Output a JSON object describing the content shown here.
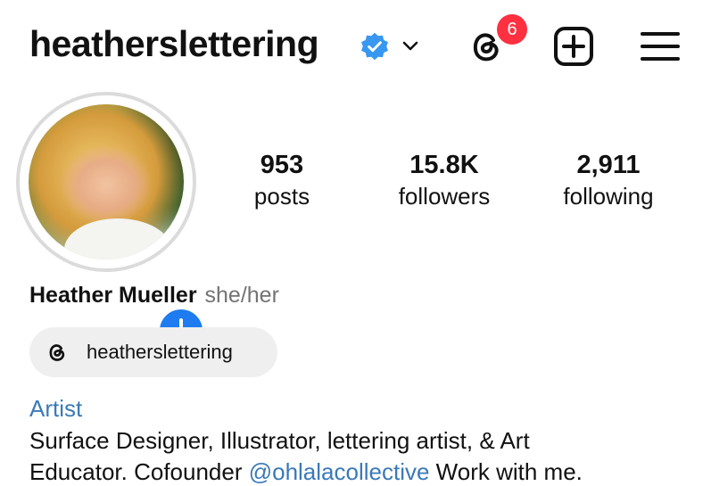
{
  "header": {
    "username": "heatherslettering",
    "verified_icon": "verified-badge-icon",
    "dropdown_icon": "chevron-down-icon",
    "threads_icon": "threads-icon",
    "notification_count": "6",
    "new_post_icon": "plus-square-icon",
    "menu_icon": "hamburger-menu-icon"
  },
  "profile": {
    "avatar_icon": "profile-photo",
    "add_story_icon": "plus-icon",
    "stats": [
      {
        "value": "953",
        "label": "posts"
      },
      {
        "value": "15.8K",
        "label": "followers"
      },
      {
        "value": "2,911",
        "label": "following"
      }
    ],
    "full_name": "Heather Mueller",
    "pronouns": "she/her",
    "threads_link": "heatherslettering",
    "category": "Artist",
    "bio_line1": "Surface Designer, Illustrator, lettering artist, & Art",
    "bio_line2_pre": "Educator. Cofounder ",
    "bio_mention": "@ohlalacollective",
    "bio_line2_post": " Work with me."
  },
  "colors": {
    "accent_blue": "#1e7cf0",
    "link_blue": "#3a79b8",
    "badge_red": "#ff3040",
    "verified_blue": "#3897f0"
  }
}
